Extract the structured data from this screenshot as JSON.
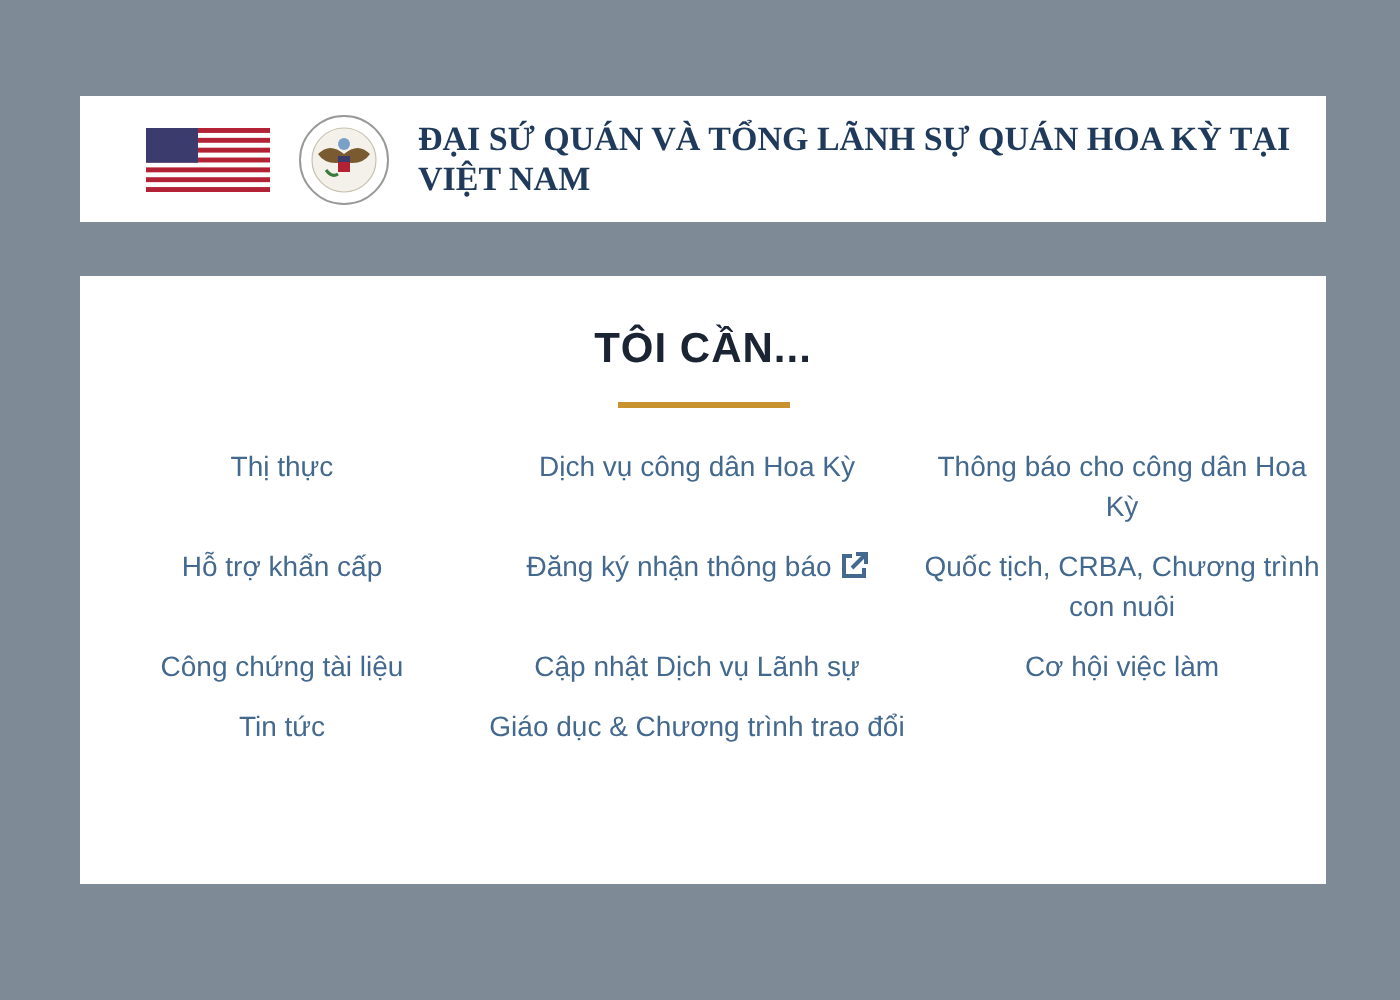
{
  "header": {
    "title": "ĐẠI SỨ QUÁN VÀ TỔNG LÃNH SỰ QUÁN HOA KỲ TẠI VIỆT NAM"
  },
  "section": {
    "heading": "TÔI CẦN...",
    "links": [
      {
        "label": "Thị thực",
        "external": false
      },
      {
        "label": "Dịch vụ công dân Hoa Kỳ",
        "external": false
      },
      {
        "label": "Thông báo cho công dân Hoa Kỳ",
        "external": false
      },
      {
        "label": "Hỗ trợ khẩn cấp",
        "external": false
      },
      {
        "label": "Đăng ký nhận thông báo",
        "external": true
      },
      {
        "label": "Quốc tịch, CRBA, Chương trình con nuôi",
        "external": false
      },
      {
        "label": "Công chứng tài liệu",
        "external": false
      },
      {
        "label": "Cập nhật Dịch vụ Lãnh sự",
        "external": false
      },
      {
        "label": "Cơ hội việc làm",
        "external": false
      },
      {
        "label": "Tin tức",
        "external": false
      },
      {
        "label": "Giáo dục & Chương trình trao đổi",
        "external": false
      }
    ]
  }
}
